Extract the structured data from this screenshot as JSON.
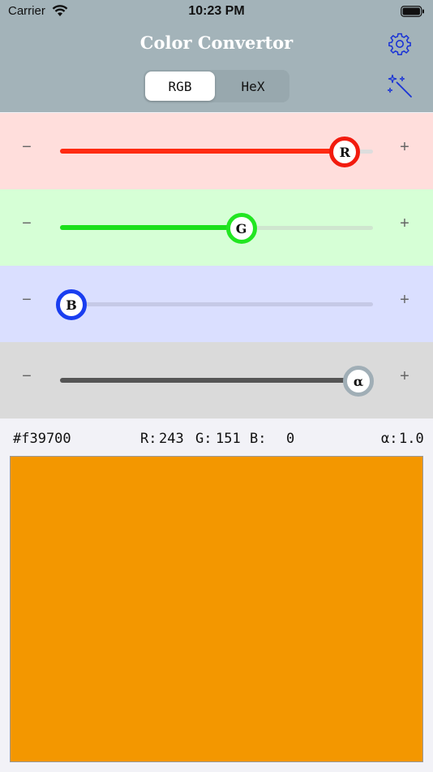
{
  "status": {
    "carrier": "Carrier",
    "time": "10:23 PM"
  },
  "header": {
    "title": "Color Convertor",
    "segments": [
      "RGB",
      "HeX"
    ]
  },
  "sliders": [
    {
      "label": "R",
      "value": 243,
      "max": 255,
      "bg": "#ffdedc",
      "fill": "#ff2a12",
      "knob_border": "#f21b0e",
      "track": "#dddddd"
    },
    {
      "label": "G",
      "value": 151,
      "max": 255,
      "bg": "#d6ffd6",
      "fill": "#1be01b",
      "knob_border": "#22e622",
      "track": "#cfe6cf"
    },
    {
      "label": "B",
      "value": 0,
      "max": 255,
      "bg": "#dadfff",
      "fill": "#1a3cf0",
      "knob_border": "#1a3ef0",
      "track": "#c5c9e6"
    },
    {
      "label": "α",
      "value": 1.0,
      "max": 1.0,
      "bg": "#dadada",
      "fill": "#555555",
      "knob_border": "#a0aeb6",
      "track": "#c8c8c8"
    }
  ],
  "controls": {
    "minus": "−",
    "plus": "+"
  },
  "info": {
    "hex": "#f39700",
    "r_label": "R:",
    "r": "243",
    "g_label": "G:",
    "g": "151",
    "b_label": "B:",
    "b": "0",
    "a_label": "α:",
    "a": "1.0"
  },
  "preview_color": "#f39700",
  "icons": {
    "settings": "gear-icon",
    "random": "magic-wand-icon"
  }
}
